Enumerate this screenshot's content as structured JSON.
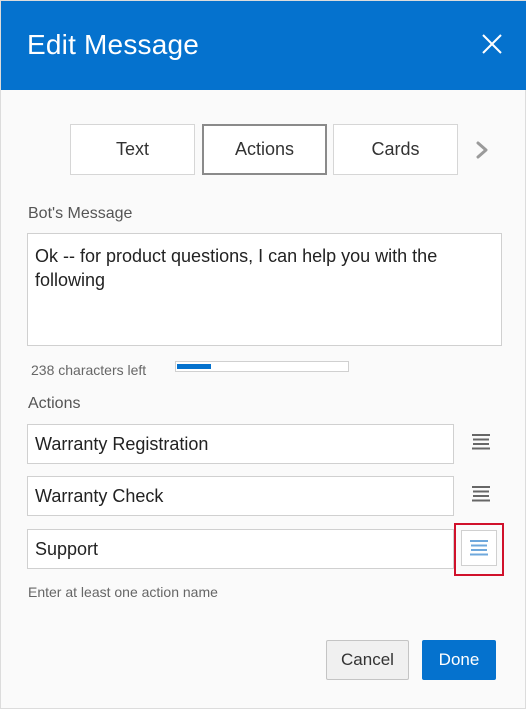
{
  "dialog": {
    "title": "Edit Message",
    "close_icon": "close-icon"
  },
  "tabs": [
    {
      "label": "Text",
      "active": false
    },
    {
      "label": "Actions",
      "active": true
    },
    {
      "label": "Cards",
      "active": false
    }
  ],
  "tab_next_icon": "chevron-right-icon",
  "bot_message": {
    "label": "Bot's Message",
    "value": "Ok -- for product questions, I can help you with the following",
    "chars_left": "238 characters left",
    "progress_fraction": 0.2
  },
  "actions": {
    "label": "Actions",
    "items": [
      {
        "value": "Warranty Registration",
        "handle_icon": "drag-handle-icon"
      },
      {
        "value": "Warranty Check",
        "handle_icon": "drag-handle-icon"
      },
      {
        "value": "Support",
        "handle_icon": "drag-handle-icon",
        "highlighted": true
      }
    ],
    "hint": "Enter at least one action name"
  },
  "footer": {
    "cancel_label": "Cancel",
    "done_label": "Done"
  },
  "colors": {
    "accent": "#0572ce",
    "highlight_border": "#d0112b"
  }
}
